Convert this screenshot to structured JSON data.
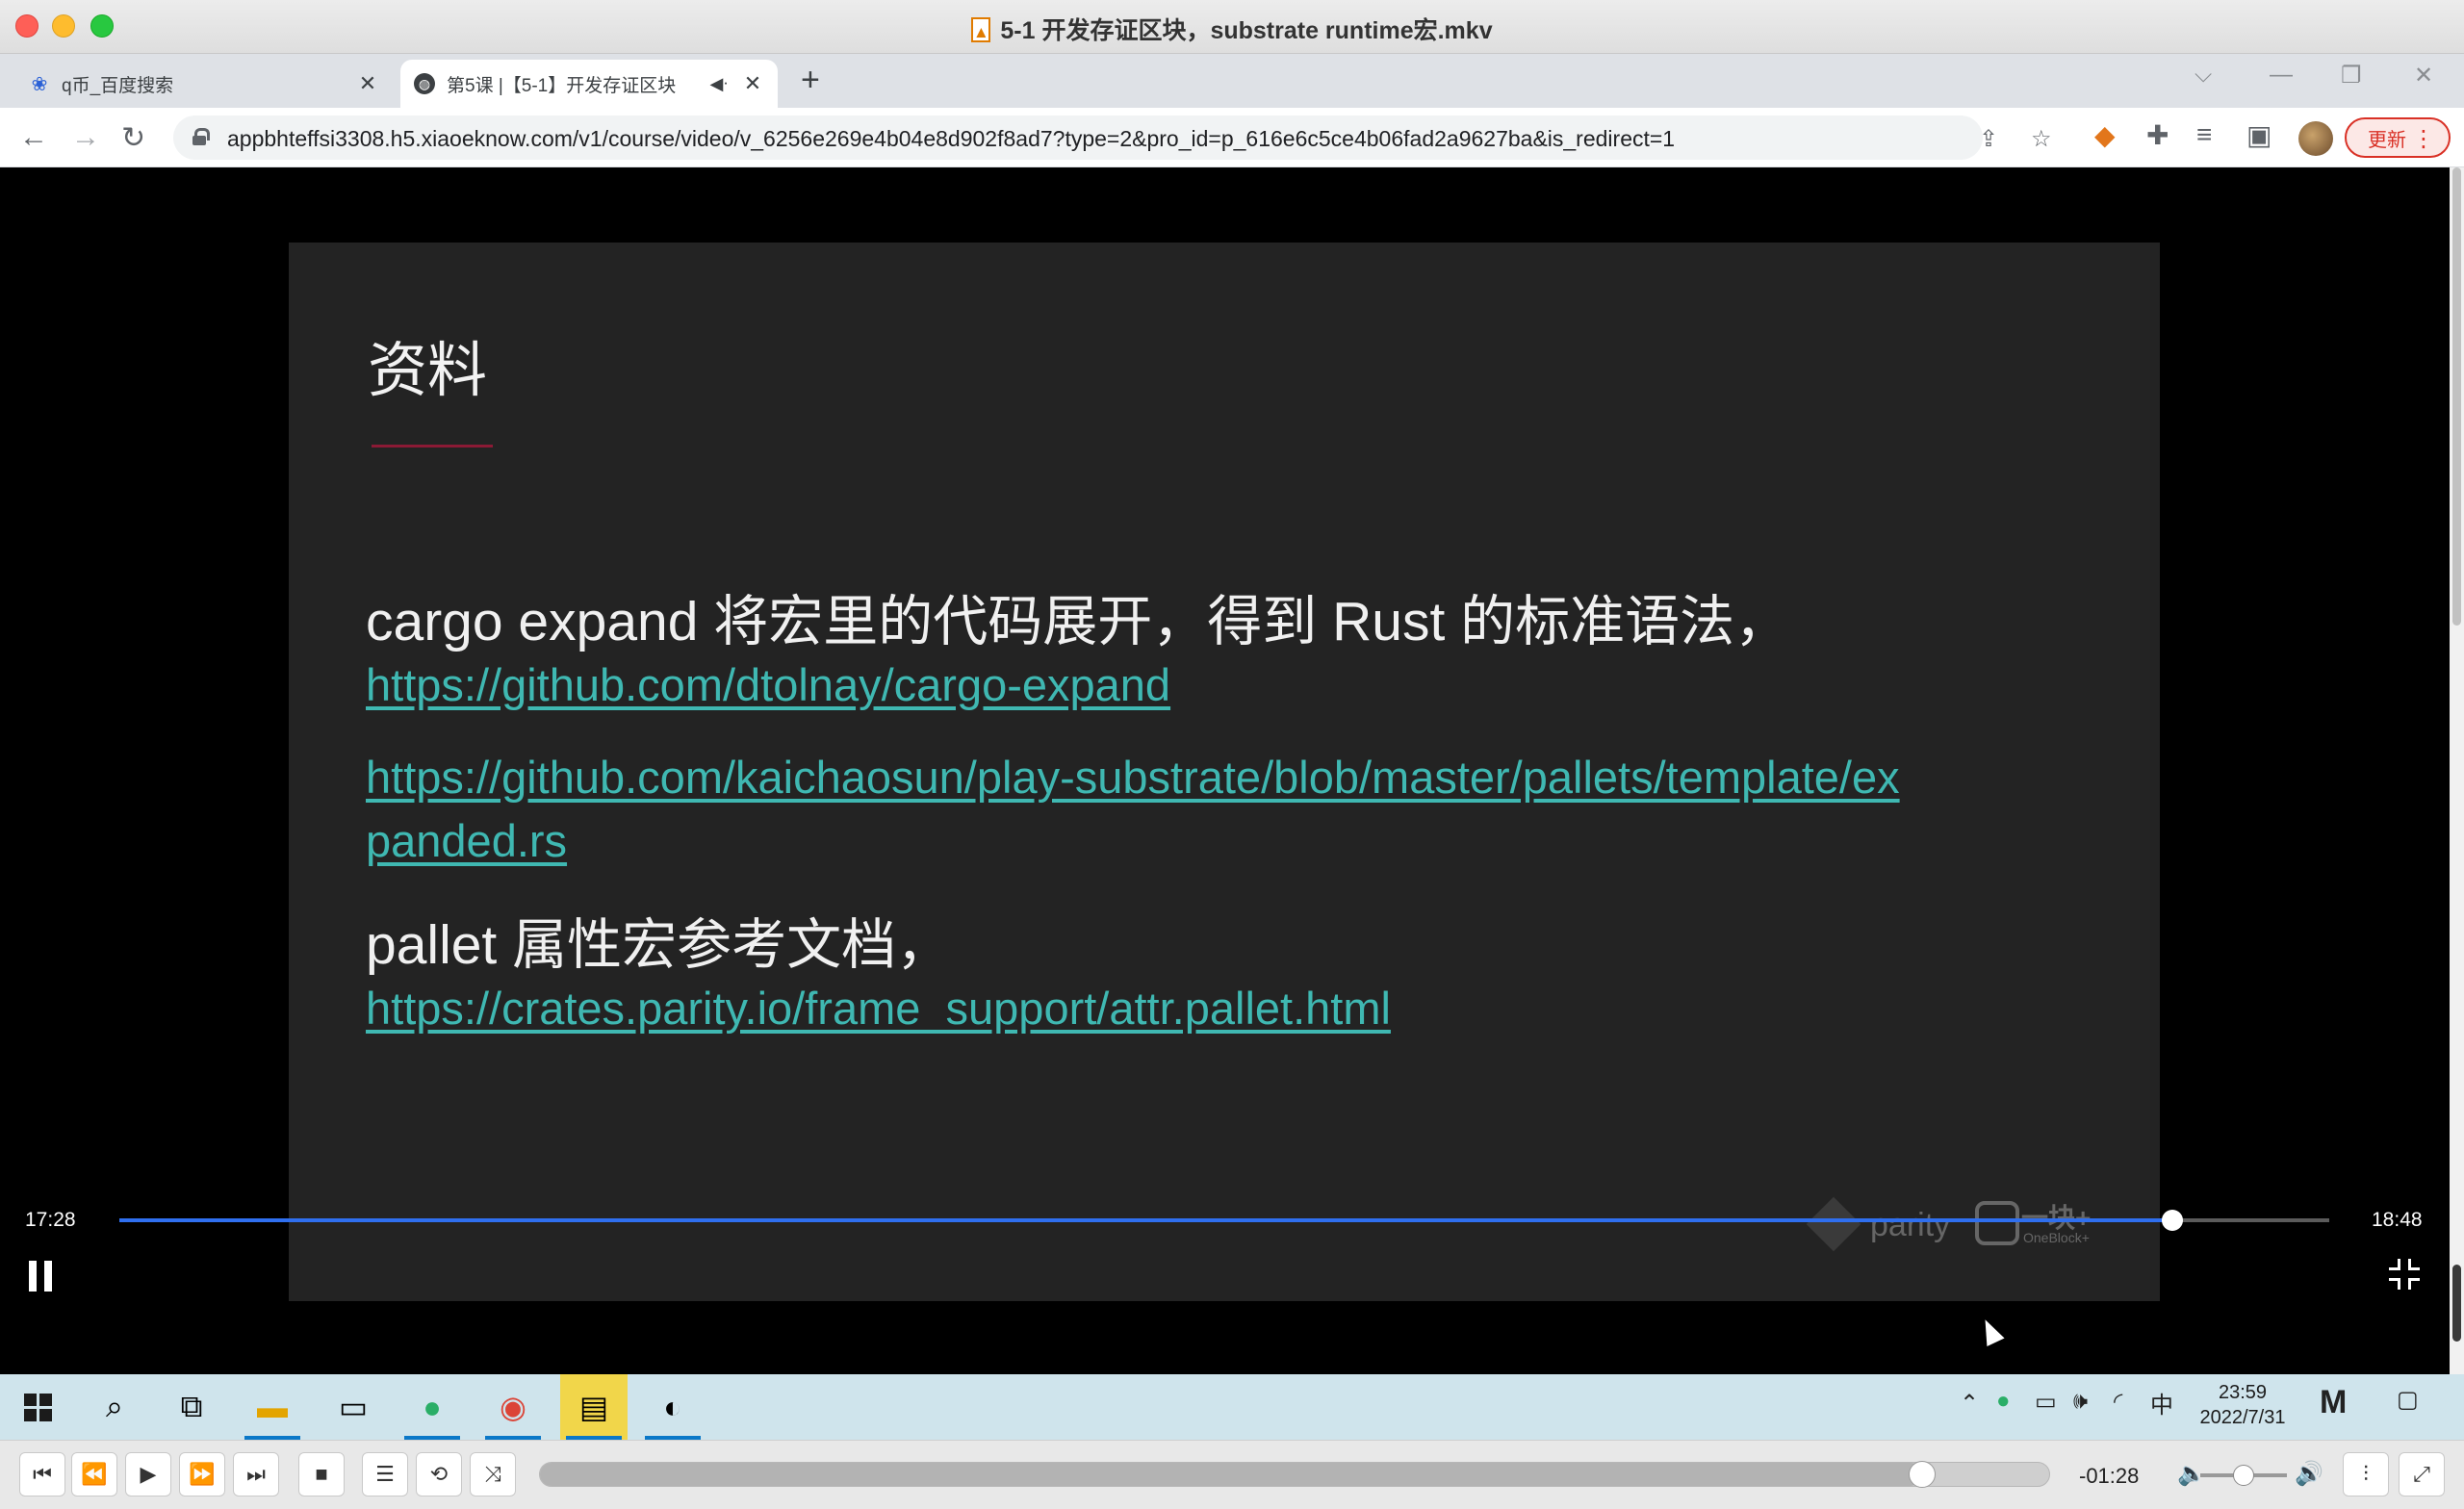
{
  "window": {
    "title": "5-1 开发存证区块，substrate runtime宏.mkv"
  },
  "tabs": [
    {
      "label": "q币_百度搜索",
      "favicon": "baidu-paw-icon",
      "active": false
    },
    {
      "label": "第5课 |【5-1】开发存证区块",
      "favicon": "globe-icon",
      "active": true,
      "audio": true
    }
  ],
  "browser": {
    "url": "appbhteffsi3308.h5.xiaoeknow.com/v1/course/video/v_6256e269e4b04e8d902f8ad7?type=2&pro_id=p_616e6c5ce4b06fad2a9627ba&is_redirect=1",
    "update_label": "更新"
  },
  "slide": {
    "title": "资料",
    "line1": "cargo expand 将宏里的代码展开，得到 Rust 的标准语法，",
    "link1": "https://github.com/dtolnay/cargo-expand",
    "link2a": "https://github.com/kaichaosun/play-substrate/blob/master/pallets/template/ex",
    "link2b": "panded.rs",
    "line2": "pallet 属性宏参考文档，",
    "link3": "https://crates.parity.io/frame_support/attr.pallet.html",
    "watermark_parity": "parity",
    "watermark_oneblock_cn": "一块+",
    "watermark_oneblock_en": "OneBlock+"
  },
  "web_player": {
    "current_time": "17:28",
    "duration": "18:48",
    "progress_fraction": 0.929
  },
  "taskbar": {
    "time": "23:59",
    "date": "2022/7/31",
    "ime": "中"
  },
  "media_player": {
    "remaining": "-01:28",
    "seek_fraction": 0.916,
    "volume_fraction": 0.5
  },
  "colors": {
    "link": "#3fb8b2",
    "progress": "#2f6fef",
    "slide_bg": "#232323",
    "accent_rule": "#8b1a35"
  }
}
